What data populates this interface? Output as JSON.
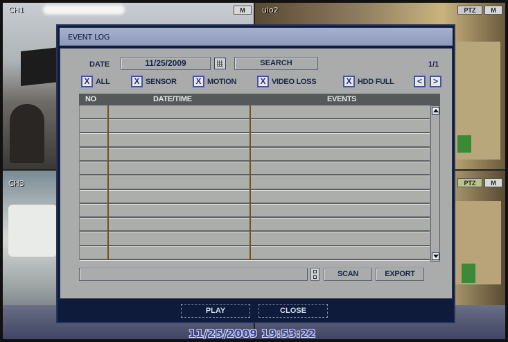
{
  "cameras": {
    "ch1": {
      "label": "CH1",
      "badge": "M"
    },
    "ch2": {
      "label": "uio2",
      "pt_badge": "PTZ",
      "badge": "M"
    },
    "ch3": {
      "label": "CH3"
    },
    "ch4": {
      "pt_badge": "PTZ",
      "badge": "M"
    }
  },
  "dialog": {
    "title": "EVENT LOG",
    "date_label": "DATE",
    "date_value": "11/25/2009",
    "search_label": "SEARCH",
    "page_indicator": "1/1",
    "filters": [
      {
        "label": "ALL",
        "checked": "X"
      },
      {
        "label": "SENSOR",
        "checked": "X"
      },
      {
        "label": "MOTION",
        "checked": "X"
      },
      {
        "label": "VIDEO LOSS",
        "checked": "X"
      },
      {
        "label": "HDD FULL",
        "checked": "X"
      }
    ],
    "prev_label": "<",
    "next_label": ">",
    "table": {
      "headers": {
        "no": "NO",
        "datetime": "DATE/TIME",
        "events": "EVENTS"
      },
      "rows": [
        "",
        "",
        "",
        "",
        "",
        "",
        "",
        "",
        "",
        "",
        ""
      ]
    },
    "scan_label": "SCAN",
    "export_label": "EXPORT",
    "play_label": "PLAY",
    "close_label": "CLOSE"
  },
  "timestamp": "11/25/2009 19:53:22"
}
